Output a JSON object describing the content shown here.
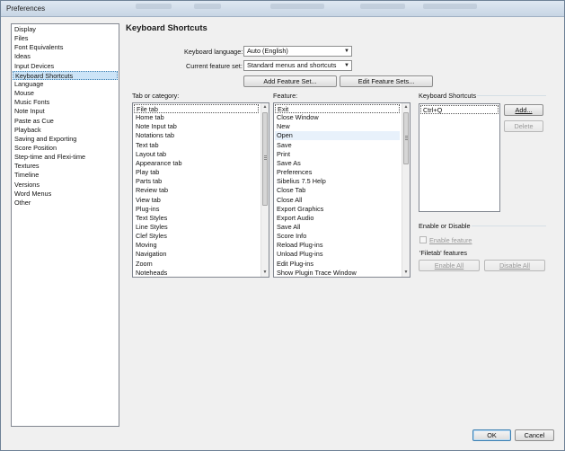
{
  "window": {
    "title": "Preferences"
  },
  "sidebar": {
    "items": [
      {
        "label": "Display"
      },
      {
        "label": "Files"
      },
      {
        "label": "Font Equivalents"
      },
      {
        "label": "Ideas"
      },
      {
        "label": "Input Devices"
      },
      {
        "label": "Keyboard Shortcuts",
        "selected": true
      },
      {
        "label": "Language"
      },
      {
        "label": "Mouse"
      },
      {
        "label": "Music Fonts"
      },
      {
        "label": "Note Input"
      },
      {
        "label": "Paste as Cue"
      },
      {
        "label": "Playback"
      },
      {
        "label": "Saving and Exporting"
      },
      {
        "label": "Score Position"
      },
      {
        "label": "Step-time and Flexi-time"
      },
      {
        "label": "Textures"
      },
      {
        "label": "Timeline"
      },
      {
        "label": "Versions"
      },
      {
        "label": "Word Menus"
      },
      {
        "label": "Other"
      }
    ]
  },
  "main": {
    "heading": "Keyboard Shortcuts",
    "keyboard_language": {
      "label": "Keyboard language:",
      "value": "Auto (English)"
    },
    "feature_set": {
      "label": "Current feature set:",
      "value": "Standard menus and shortcuts"
    },
    "add_feature_set": "Add Feature Set...",
    "edit_feature_sets": "Edit Feature Sets...",
    "tab_or_category": {
      "label": "Tab or category:",
      "items": [
        "File tab",
        "Home tab",
        "Note Input tab",
        "Notations tab",
        "Text tab",
        "Layout tab",
        "Appearance tab",
        "Play tab",
        "Parts tab",
        "Review tab",
        "View tab",
        "Plug-ins",
        "Text Styles",
        "Line Styles",
        "Clef Styles",
        "Moving",
        "Navigation",
        "Zoom",
        "Noteheads"
      ],
      "selected_index": 0
    },
    "feature": {
      "label": "Feature:",
      "items": [
        "Exit",
        "Close Window",
        "New",
        "Open",
        "Save",
        "Print",
        "Save As",
        "Preferences",
        "Sibelius 7.5 Help",
        "Close Tab",
        "Close All",
        "Export Graphics",
        "Export Audio",
        "Save All",
        "Score Info",
        "Reload Plug-ins",
        "Unload Plug-ins",
        "Edit Plug-ins",
        "Show Plugin Trace Window"
      ],
      "selected_index": 0,
      "highlighted_index": 3
    },
    "shortcuts": {
      "label": "Keyboard Shortcuts",
      "items": [
        "Ctrl+Q"
      ],
      "add": "Add...",
      "delete": "Delete"
    },
    "enable_disable": {
      "label": "Enable or Disable",
      "enable_feature": "Enable feature",
      "features_caption": "'Filetab' features",
      "enable_all": "Enable All",
      "disable_all": "Disable All"
    }
  },
  "footer": {
    "ok": "OK",
    "cancel": "Cancel"
  },
  "colors": {
    "selection": "#cce4f7",
    "focus_border": "#3c7fb1"
  }
}
